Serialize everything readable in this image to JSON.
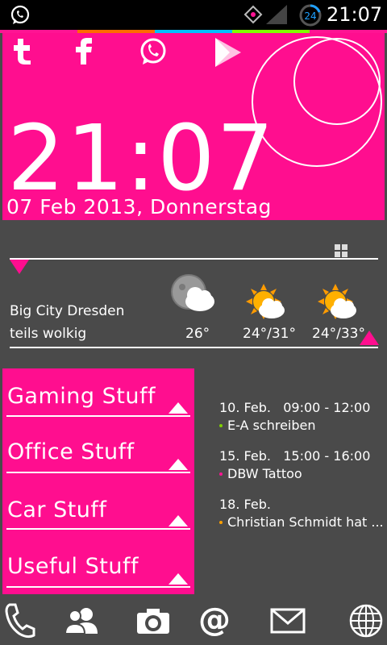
{
  "status_bar": {
    "time": "21:07",
    "battery_level": "24"
  },
  "clock": {
    "time": "21:07",
    "date": "07 Feb 2013, Donnerstag"
  },
  "weather": {
    "city": "Big City Dresden",
    "condition": "teils wolkig",
    "forecast": [
      {
        "icon": "moon-cloud-icon",
        "temp": "26°"
      },
      {
        "icon": "sun-cloud-icon",
        "temp": "24°/31°"
      },
      {
        "icon": "sun-cloud-icon",
        "temp": "24°/33°"
      }
    ]
  },
  "categories": [
    "Gaming Stuff",
    "Office Stuff",
    "Car Stuff",
    "Useful Stuff"
  ],
  "events": [
    {
      "date": "10. Feb.",
      "time": "09:00 - 12:00",
      "title": "E-A schreiben",
      "dot_color": "#7fd000"
    },
    {
      "date": "15. Feb.",
      "time": "15:00 - 16:00",
      "title": "DBW Tattoo",
      "dot_color": "#ff1493"
    },
    {
      "date": "18. Feb.",
      "time": "",
      "title": "Christian Schmidt hat ...",
      "dot_color": "#ffa000"
    }
  ],
  "colors": {
    "accent": "#ff0e8f",
    "background": "#4a4a4a"
  }
}
